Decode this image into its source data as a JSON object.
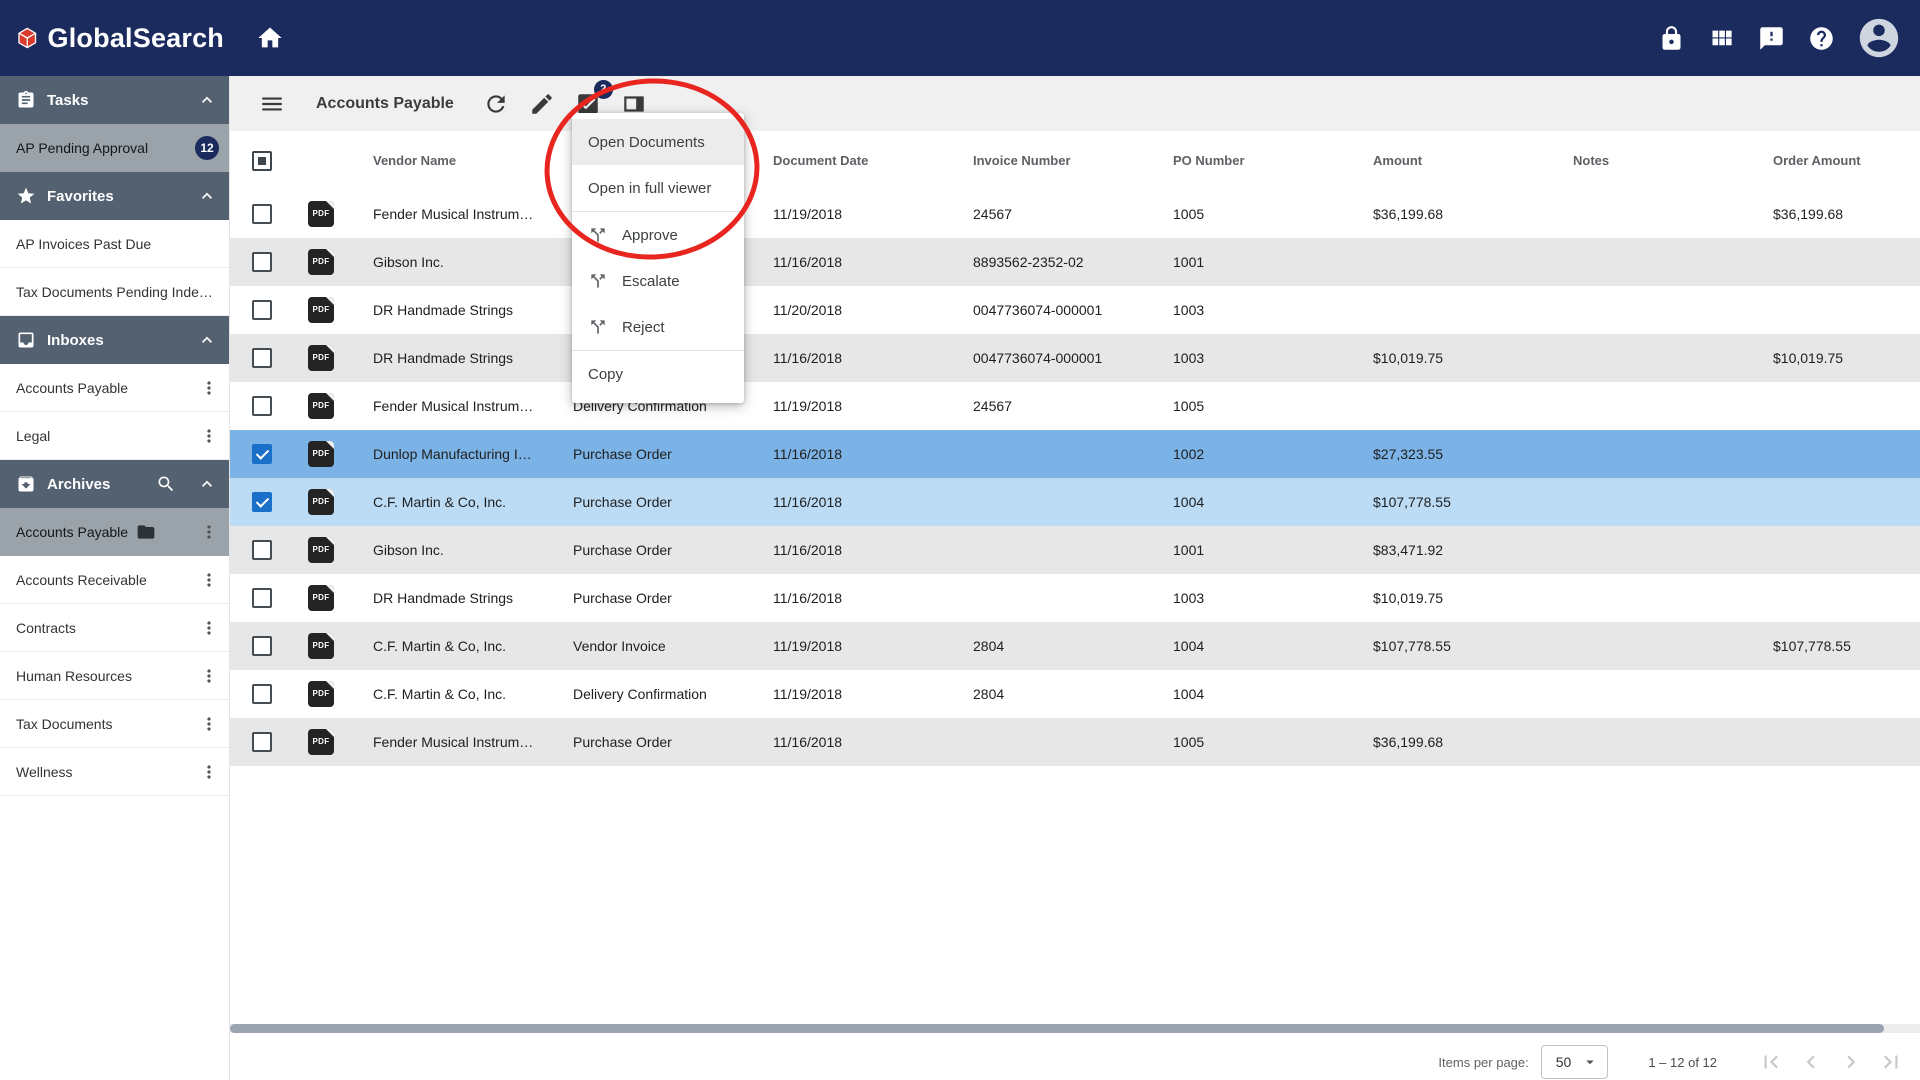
{
  "topbar": {
    "brand": "GlobalSearch",
    "nav_icons": [
      "home-icon"
    ],
    "right_icons": [
      "lock-icon",
      "view-module-icon",
      "feedback-icon",
      "help-icon",
      "account-icon"
    ]
  },
  "sidebar": {
    "sections": [
      {
        "label": "Tasks",
        "icon": "tasks-icon",
        "items": [
          {
            "label": "AP Pending Approval",
            "badge": "12",
            "selected": true
          }
        ]
      },
      {
        "label": "Favorites",
        "icon": "star-icon",
        "items": [
          {
            "label": "AP Invoices Past Due"
          },
          {
            "label": "Tax Documents Pending Inde…"
          }
        ]
      },
      {
        "label": "Inboxes",
        "icon": "inbox-icon",
        "items": [
          {
            "label": "Accounts Payable",
            "kebab": true
          },
          {
            "label": "Legal",
            "kebab": true
          }
        ]
      },
      {
        "label": "Archives",
        "icon": "archive-icon",
        "search": true,
        "items": [
          {
            "label": "Accounts Payable",
            "selected": true,
            "folder": true,
            "kebab": true
          },
          {
            "label": "Accounts Receivable",
            "kebab": true
          },
          {
            "label": "Contracts",
            "kebab": true
          },
          {
            "label": "Human Resources",
            "kebab": true
          },
          {
            "label": "Tax Documents",
            "kebab": true
          },
          {
            "label": "Wellness",
            "kebab": true
          }
        ]
      }
    ]
  },
  "toolbar": {
    "title": "Accounts Payable",
    "selection_badge": "2"
  },
  "context_menu": {
    "groups": [
      {
        "items": [
          {
            "label": "Open Documents",
            "hover": true
          },
          {
            "label": "Open in full viewer"
          }
        ]
      },
      {
        "items": [
          {
            "label": "Approve",
            "icon": "workflow-split-icon"
          },
          {
            "label": "Escalate",
            "icon": "workflow-split-icon"
          },
          {
            "label": "Reject",
            "icon": "workflow-split-icon"
          }
        ]
      },
      {
        "items": [
          {
            "label": "Copy"
          }
        ]
      }
    ]
  },
  "table": {
    "pdf_icon_label": "PDF",
    "columns": [
      "Vendor Name",
      "",
      "Document Date",
      "Invoice Number",
      "PO Number",
      "Amount",
      "Notes",
      "Order Amount"
    ],
    "rows": [
      {
        "checked": false,
        "highlight": "",
        "vendor": "Fender Musical Instrum…",
        "doc_type": "",
        "doc_date": "11/19/2018",
        "invoice": "24567",
        "po": "1005",
        "amount": "$36,199.68",
        "notes": "",
        "order_amount": "$36,199.68"
      },
      {
        "checked": false,
        "highlight": "",
        "vendor": "Gibson Inc.",
        "doc_type": "",
        "doc_date": "11/16/2018",
        "invoice": "8893562-2352-02",
        "po": "1001",
        "amount": "",
        "notes": "",
        "order_amount": ""
      },
      {
        "checked": false,
        "highlight": "",
        "vendor": "DR Handmade Strings",
        "doc_type": "",
        "doc_date": "11/20/2018",
        "invoice": "0047736074-000001",
        "po": "1003",
        "amount": "",
        "notes": "",
        "order_amount": ""
      },
      {
        "checked": false,
        "highlight": "",
        "vendor": "DR Handmade Strings",
        "doc_type": "",
        "doc_date": "11/16/2018",
        "invoice": "0047736074-000001",
        "po": "1003",
        "amount": "$10,019.75",
        "notes": "",
        "order_amount": "$10,019.75"
      },
      {
        "checked": false,
        "highlight": "",
        "vendor": "Fender Musical Instrum…",
        "doc_type": "Delivery Confirmation",
        "doc_date": "11/19/2018",
        "invoice": "24567",
        "po": "1005",
        "amount": "",
        "notes": "",
        "order_amount": ""
      },
      {
        "checked": true,
        "highlight": "strong",
        "vendor": "Dunlop Manufacturing I…",
        "doc_type": "Purchase Order",
        "doc_date": "11/16/2018",
        "invoice": "",
        "po": "1002",
        "amount": "$27,323.55",
        "notes": "",
        "order_amount": ""
      },
      {
        "checked": true,
        "highlight": "light",
        "vendor": "C.F. Martin & Co, Inc.",
        "doc_type": "Purchase Order",
        "doc_date": "11/16/2018",
        "invoice": "",
        "po": "1004",
        "amount": "$107,778.55",
        "notes": "",
        "order_amount": ""
      },
      {
        "checked": false,
        "highlight": "",
        "vendor": "Gibson Inc.",
        "doc_type": "Purchase Order",
        "doc_date": "11/16/2018",
        "invoice": "",
        "po": "1001",
        "amount": "$83,471.92",
        "notes": "",
        "order_amount": ""
      },
      {
        "checked": false,
        "highlight": "",
        "vendor": "DR Handmade Strings",
        "doc_type": "Purchase Order",
        "doc_date": "11/16/2018",
        "invoice": "",
        "po": "1003",
        "amount": "$10,019.75",
        "notes": "",
        "order_amount": ""
      },
      {
        "checked": false,
        "highlight": "",
        "vendor": "C.F. Martin & Co, Inc.",
        "doc_type": "Vendor Invoice",
        "doc_date": "11/19/2018",
        "invoice": "2804",
        "po": "1004",
        "amount": "$107,778.55",
        "notes": "",
        "order_amount": "$107,778.55"
      },
      {
        "checked": false,
        "highlight": "",
        "vendor": "C.F. Martin & Co, Inc.",
        "doc_type": "Delivery Confirmation",
        "doc_date": "11/19/2018",
        "invoice": "2804",
        "po": "1004",
        "amount": "",
        "notes": "",
        "order_amount": ""
      },
      {
        "checked": false,
        "highlight": "",
        "vendor": "Fender Musical Instrum…",
        "doc_type": "Purchase Order",
        "doc_date": "11/16/2018",
        "invoice": "",
        "po": "1005",
        "amount": "$36,199.68",
        "notes": "",
        "order_amount": ""
      }
    ]
  },
  "pagination": {
    "items_per_page_label": "Items per page:",
    "items_per_page": "50",
    "range": "1 – 12 of 12"
  },
  "colors": {
    "topbar_navy": "#1c2b5e",
    "section_header": "#546170",
    "selected_sidebar": "#9ba3aa",
    "row_stripe": "#e7e7e7",
    "selected_row_strong": "#7cb3e6",
    "selected_row_light": "#bcdcf5",
    "checkbox_checked": "#1a70c8",
    "annotation_red": "#e8261f"
  }
}
